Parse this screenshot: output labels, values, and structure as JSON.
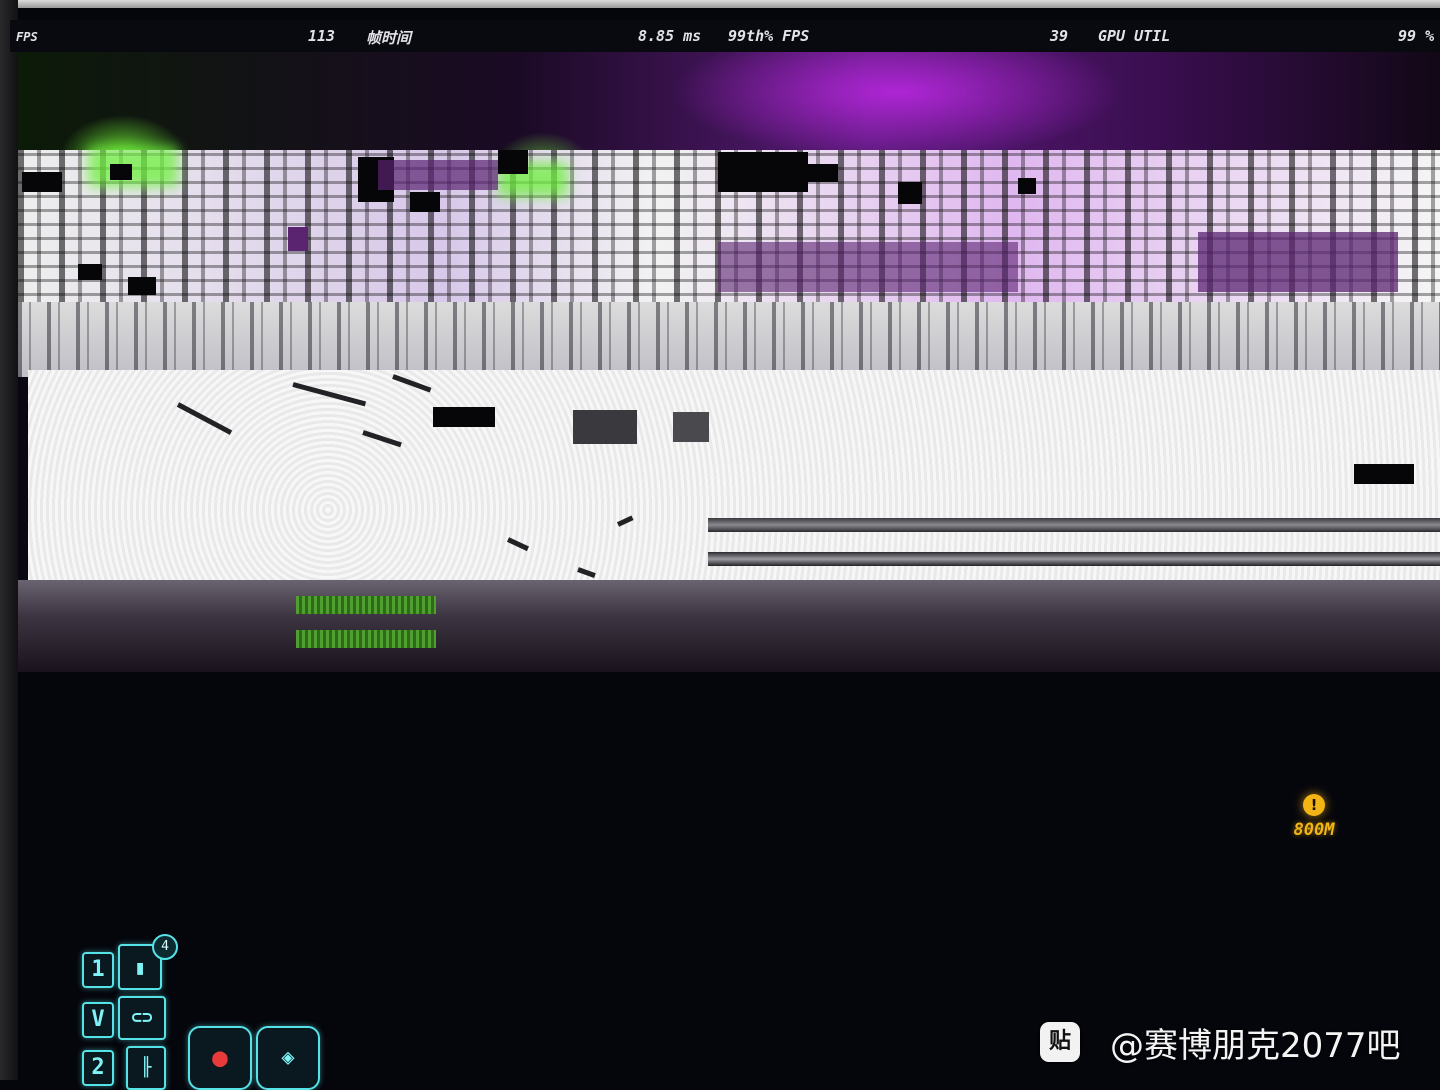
{
  "perf_overlay": {
    "fps_label": "FPS",
    "fps_value": "113",
    "frametime_label": "帧时间",
    "frametime_value": "8.85 ms",
    "p99_label": "99th% FPS",
    "p99_value": "39",
    "gpu_util_label": "GPU UTIL",
    "gpu_util_value": "99 %"
  },
  "hud": {
    "objective": {
      "icon": "!",
      "distance": "800M",
      "color": "#f3b416"
    },
    "quickslots": {
      "slot1_key": "1",
      "slot1_count": "4",
      "vehicle_key": "V",
      "slot2_key": "2",
      "accent_color": "#56e3e8"
    }
  },
  "watermark": {
    "logo": "贴",
    "text": "@赛博朋克2077吧"
  }
}
